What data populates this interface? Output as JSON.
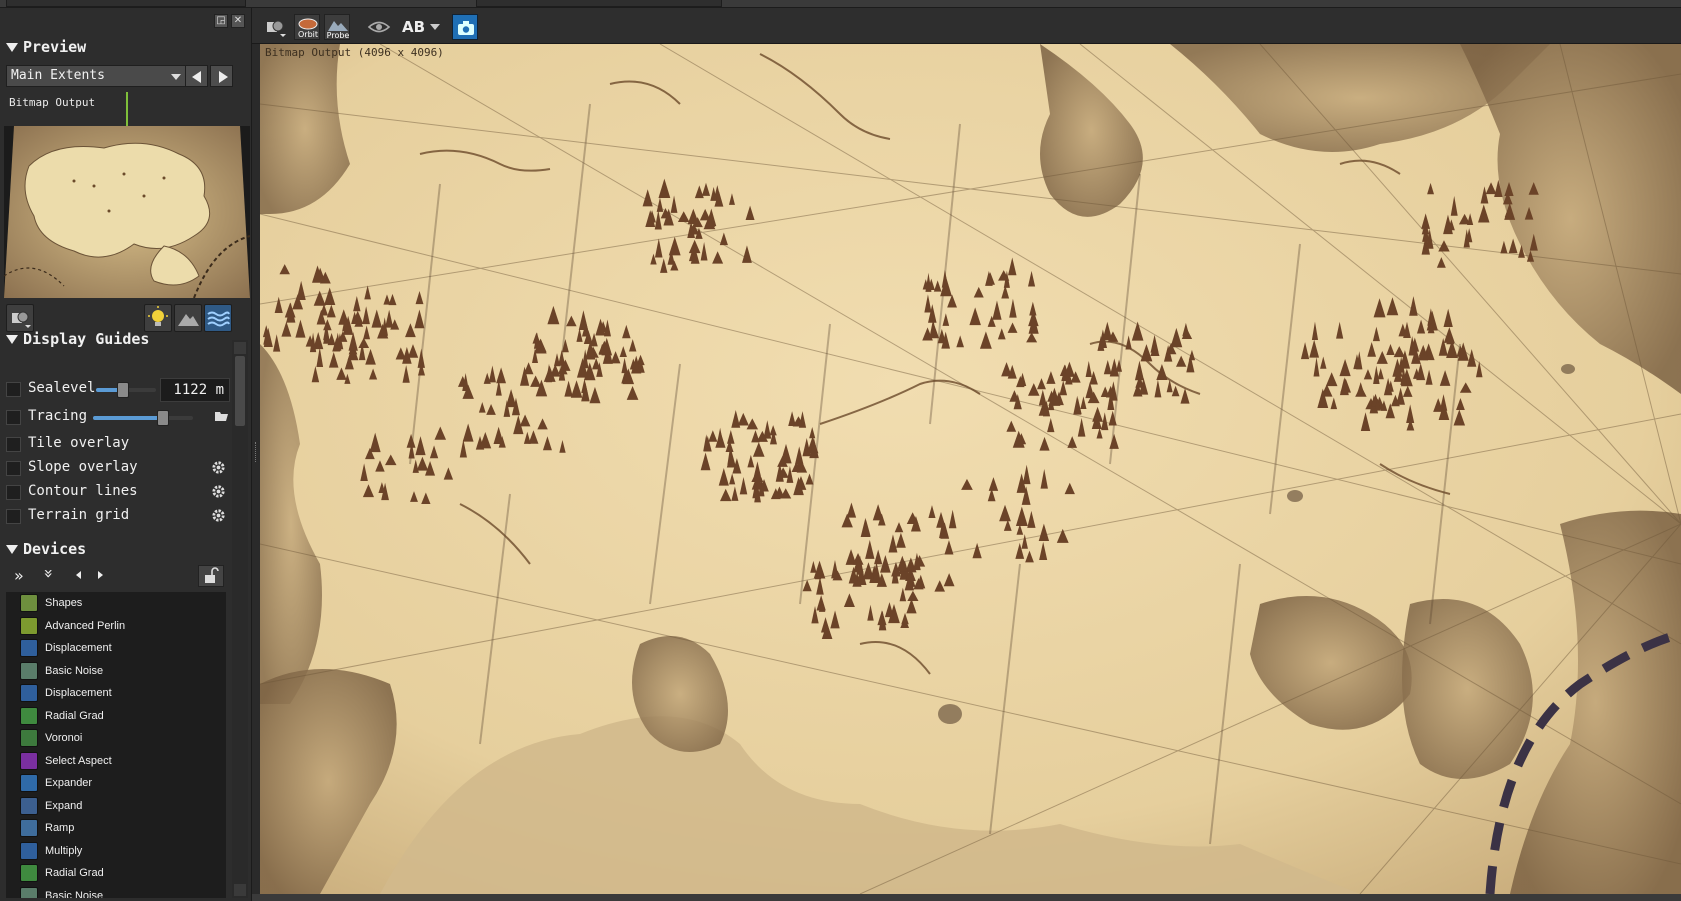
{
  "panel": {
    "preview_title": "Preview",
    "extents_value": "Main Extents",
    "bitmap_label": "Bitmap Output",
    "display_guides_title": "Display Guides",
    "guides": [
      {
        "label": "Sealevel",
        "value": "1122 m",
        "checked": false,
        "slider_level": 0.45
      },
      {
        "label": "Tracing",
        "checked": false,
        "slider_level": 0.7
      },
      {
        "label": "Tile overlay",
        "checked": false
      },
      {
        "label": "Slope overlay",
        "checked": false
      },
      {
        "label": "Contour lines",
        "checked": false
      },
      {
        "label": "Terrain grid",
        "checked": false
      }
    ],
    "devices_title": "Devices",
    "devices": [
      {
        "label": "Shapes",
        "color": "#6e8f3e"
      },
      {
        "label": "Advanced Perlin",
        "color": "#7d9a2f"
      },
      {
        "label": "Displacement",
        "color": "#2f5f9c"
      },
      {
        "label": "Basic Noise",
        "color": "#5a7d6a"
      },
      {
        "label": "Displacement",
        "color": "#2f5f9c"
      },
      {
        "label": "Radial Grad",
        "color": "#3f8a3f"
      },
      {
        "label": "Voronoi",
        "color": "#3d7a3d"
      },
      {
        "label": "Select Aspect",
        "color": "#7a2fa0"
      },
      {
        "label": "Expander",
        "color": "#2f6aa8"
      },
      {
        "label": "Expand",
        "color": "#3c5f8f"
      },
      {
        "label": "Ramp",
        "color": "#3f6d9c"
      },
      {
        "label": "Multiply",
        "color": "#2f5f9c"
      },
      {
        "label": "Radial Grad",
        "color": "#3f8a3f"
      },
      {
        "label": "Basic Noise",
        "color": "#5a7d6a"
      }
    ]
  },
  "viewport": {
    "title": "Bitmap Output (4096 x 4096)"
  },
  "toolbar": {
    "icons": [
      "device-menu-icon",
      "orbit-icon",
      "probe-icon",
      "eye-icon",
      "ab-compare-icon",
      "camera-icon"
    ],
    "orbit_label": "Orbit",
    "probe_label": "Probe",
    "ab_label": "AB"
  },
  "colors": {
    "accent_blue": "#5b9bd5",
    "parchment": "#e9d6a6",
    "ink": "#5a3b22",
    "panel_bg": "#2d2d2d"
  }
}
